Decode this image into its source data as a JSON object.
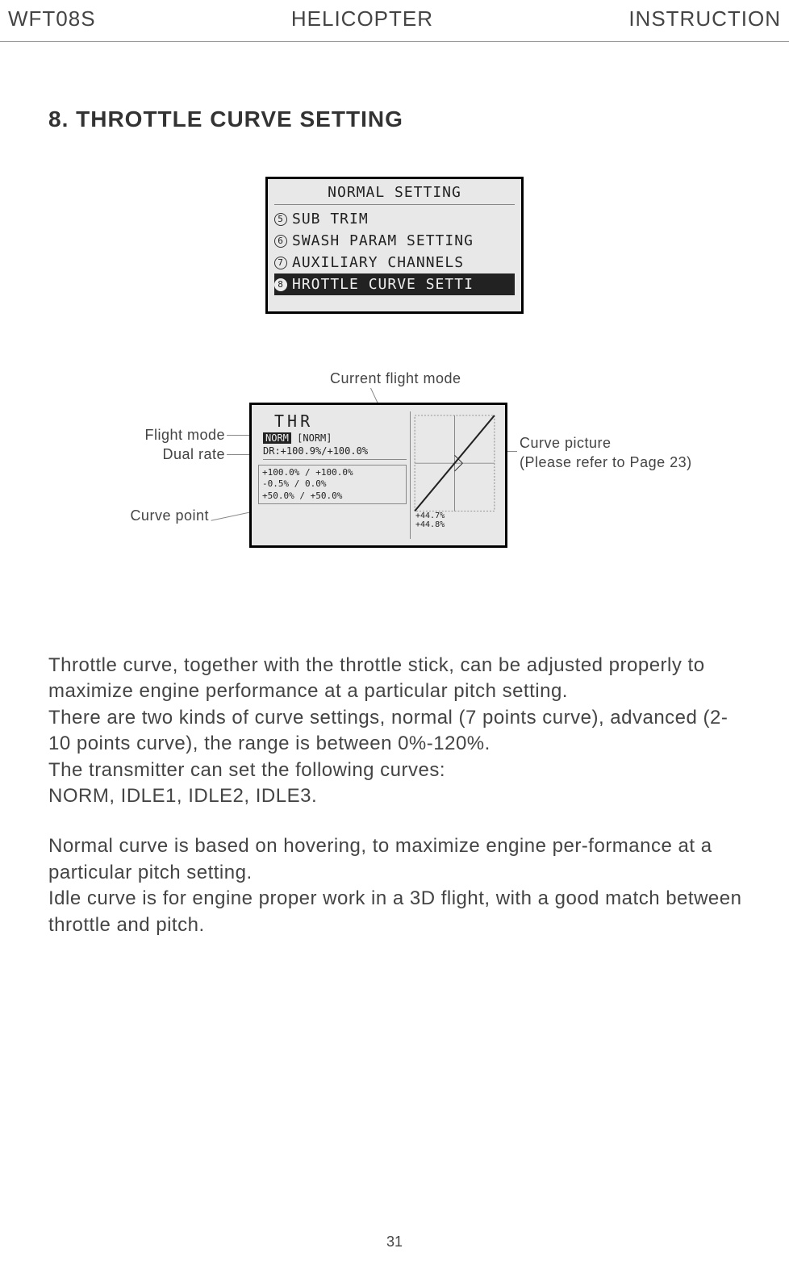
{
  "header": {
    "left": "WFT08S",
    "center": "HELICOPTER",
    "right": "INSTRUCTION"
  },
  "section_title": "8. THROTTLE CURVE SETTING",
  "lcd_menu": {
    "title": "NORMAL SETTING",
    "items": [
      {
        "num": "5",
        "label": "SUB TRIM",
        "highlight": false
      },
      {
        "num": "6",
        "label": "SWASH PARAM SETTING",
        "highlight": false
      },
      {
        "num": "7",
        "label": "AUXILIARY CHANNELS",
        "highlight": false
      },
      {
        "num": "8",
        "label": "HROTTLE CURVE SETTI",
        "highlight": true
      }
    ]
  },
  "lcd_detail": {
    "title": "THR",
    "mode_hl": "NORM",
    "mode_rest": "[NORM]",
    "dr": "DR:+100.9%/+100.0%",
    "points": [
      "+100.0% / +100.0%",
      "-0.5%  / 0.0%",
      "+50.0% / +50.0%"
    ],
    "values": [
      "+44.7%",
      "+44.8%"
    ]
  },
  "labels": {
    "top": "Current flight mode",
    "left1": "Flight mode",
    "left2": "Dual rate",
    "left3": "Curve point",
    "right1": "Curve picture",
    "right2": "(Please refer to Page 23)"
  },
  "body": {
    "p1": "Throttle curve, together with the throttle stick, can be adjusted properly to maximize engine performance at a particular pitch setting.",
    "p2": "There are two kinds of curve settings, normal (7 points curve), advanced (2-10 points curve), the range is between 0%-120%.",
    "p3": "The transmitter can set the following curves:",
    "p4": "NORM, IDLE1, IDLE2, IDLE3.",
    "p5": "Normal curve is based on hovering, to maximize engine per-formance at a particular pitch setting.",
    "p6": "Idle curve is for engine proper work in a 3D flight, with a good match between throttle and pitch."
  },
  "page_number": "31"
}
